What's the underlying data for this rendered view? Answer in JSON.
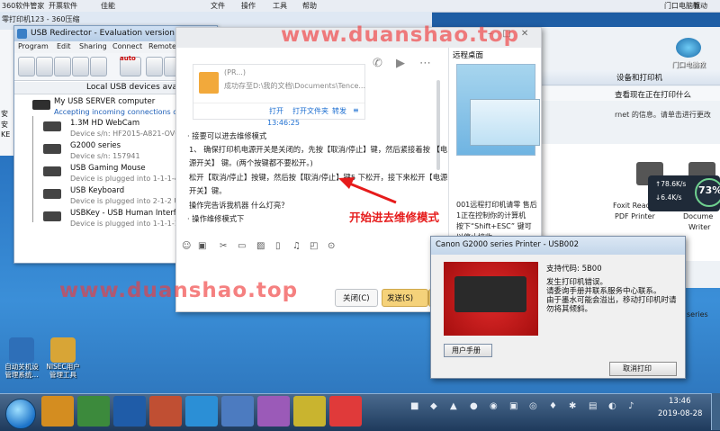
{
  "top_menubar": {
    "items": [
      "360软件管家",
      "开票软件",
      "佳能",
      "文件",
      "操作",
      "工具",
      "帮助",
      "门口电脑教",
      "驱动"
    ]
  },
  "background_window": {
    "title": "零打印机123 - 360压缩",
    "left_snips": [
      "安",
      "安",
      "KE"
    ]
  },
  "usb_redirector": {
    "title": "USB Redirector - Evaluation version",
    "menu": [
      "Program",
      "Edit",
      "Sharing",
      "Connect",
      "Remote"
    ],
    "auto_label": "auto",
    "header": "Local USB devices ava",
    "server": {
      "name": "My USB SERVER computer",
      "status": "Accepting incoming connections on"
    },
    "devices": [
      {
        "name": "1.3M HD WebCam",
        "status": "Device s/n: HF2015-A821-OV01"
      },
      {
        "name": "G2000 series",
        "status": "Device s/n: 157941"
      },
      {
        "name": "USB Gaming Mouse",
        "status": "Device is plugged into 1-1-1-4"
      },
      {
        "name": "USB Keyboard",
        "status": "Device is plugged into 2-1-2 US"
      },
      {
        "name": "USBKey - USB Human Interface",
        "status": "Device is plugged into 1-1-1-1"
      }
    ]
  },
  "chat": {
    "file_card": {
      "name": "(PR...)",
      "status": "成功存至D:\\我的文档\\Documents\\Tence...",
      "actions": [
        "打开",
        "打开文件夹",
        "转发"
      ]
    },
    "sender_time": "13:46:25",
    "messages": [
      "· 接要可以进去维修模式",
      "1、 确保打印机电源开关是关闭的，先按【取消/停止】键，然后紧接着按 【电",
      "源开关】 键。(两个按键都不要松开。)",
      "松开【取消/停止】按键，然后按【取消/停止】键5 下松开，接下来松开【电源",
      "开关】键。",
      "操作完告诉我机器 什么灯亮？",
      "· 操作维修模式下"
    ],
    "close_label": "关闭(C)",
    "send_label": "发送(S)"
  },
  "remote_panel": {
    "title": "远程桌面",
    "notes": [
      "001远程打印机请零 售后",
      "1正在控制你的计算机",
      "按下“Shift+ESC” 键可",
      "以停止接收"
    ]
  },
  "right_window": {
    "bar": "设备和打印机",
    "row": "查看现在正在打印什么",
    "info": "rnet 的信息。请单击进行更改",
    "printers": [
      "Foxit Reader",
      "PDF Printer",
      "Docume",
      "Writer"
    ],
    "series": "series"
  },
  "metrics": {
    "up": "↑78.6K/s",
    "down": "↓6.4K/s",
    "percent": "73%"
  },
  "canon_dialog": {
    "title": "Canon G2000 series Printer - USB002",
    "code": "支持代码:  5B00",
    "lines": [
      "发生打印机错误。",
      "请委询手册并联系服务中心联系。",
      "由于墨水可能会溢出，移动打印机时请",
      "勿将其倾斜。"
    ],
    "manual_label": "用户手册",
    "cancel_label": "取消打印"
  },
  "annotation": "开始进去维修模式",
  "watermarks": [
    "www.duanshao.top",
    "www.duanshao.top"
  ],
  "desktop_icons": [
    {
      "label": "自动关机设\n管理系统...",
      "color": "#2e6fb8"
    },
    {
      "label": "NISEC用户\n管理工具",
      "color": "#d8a536"
    }
  ],
  "pc_icon_label": "门口电脑教",
  "taskbar": {
    "time": "13:46",
    "date": "2019-08-28"
  }
}
